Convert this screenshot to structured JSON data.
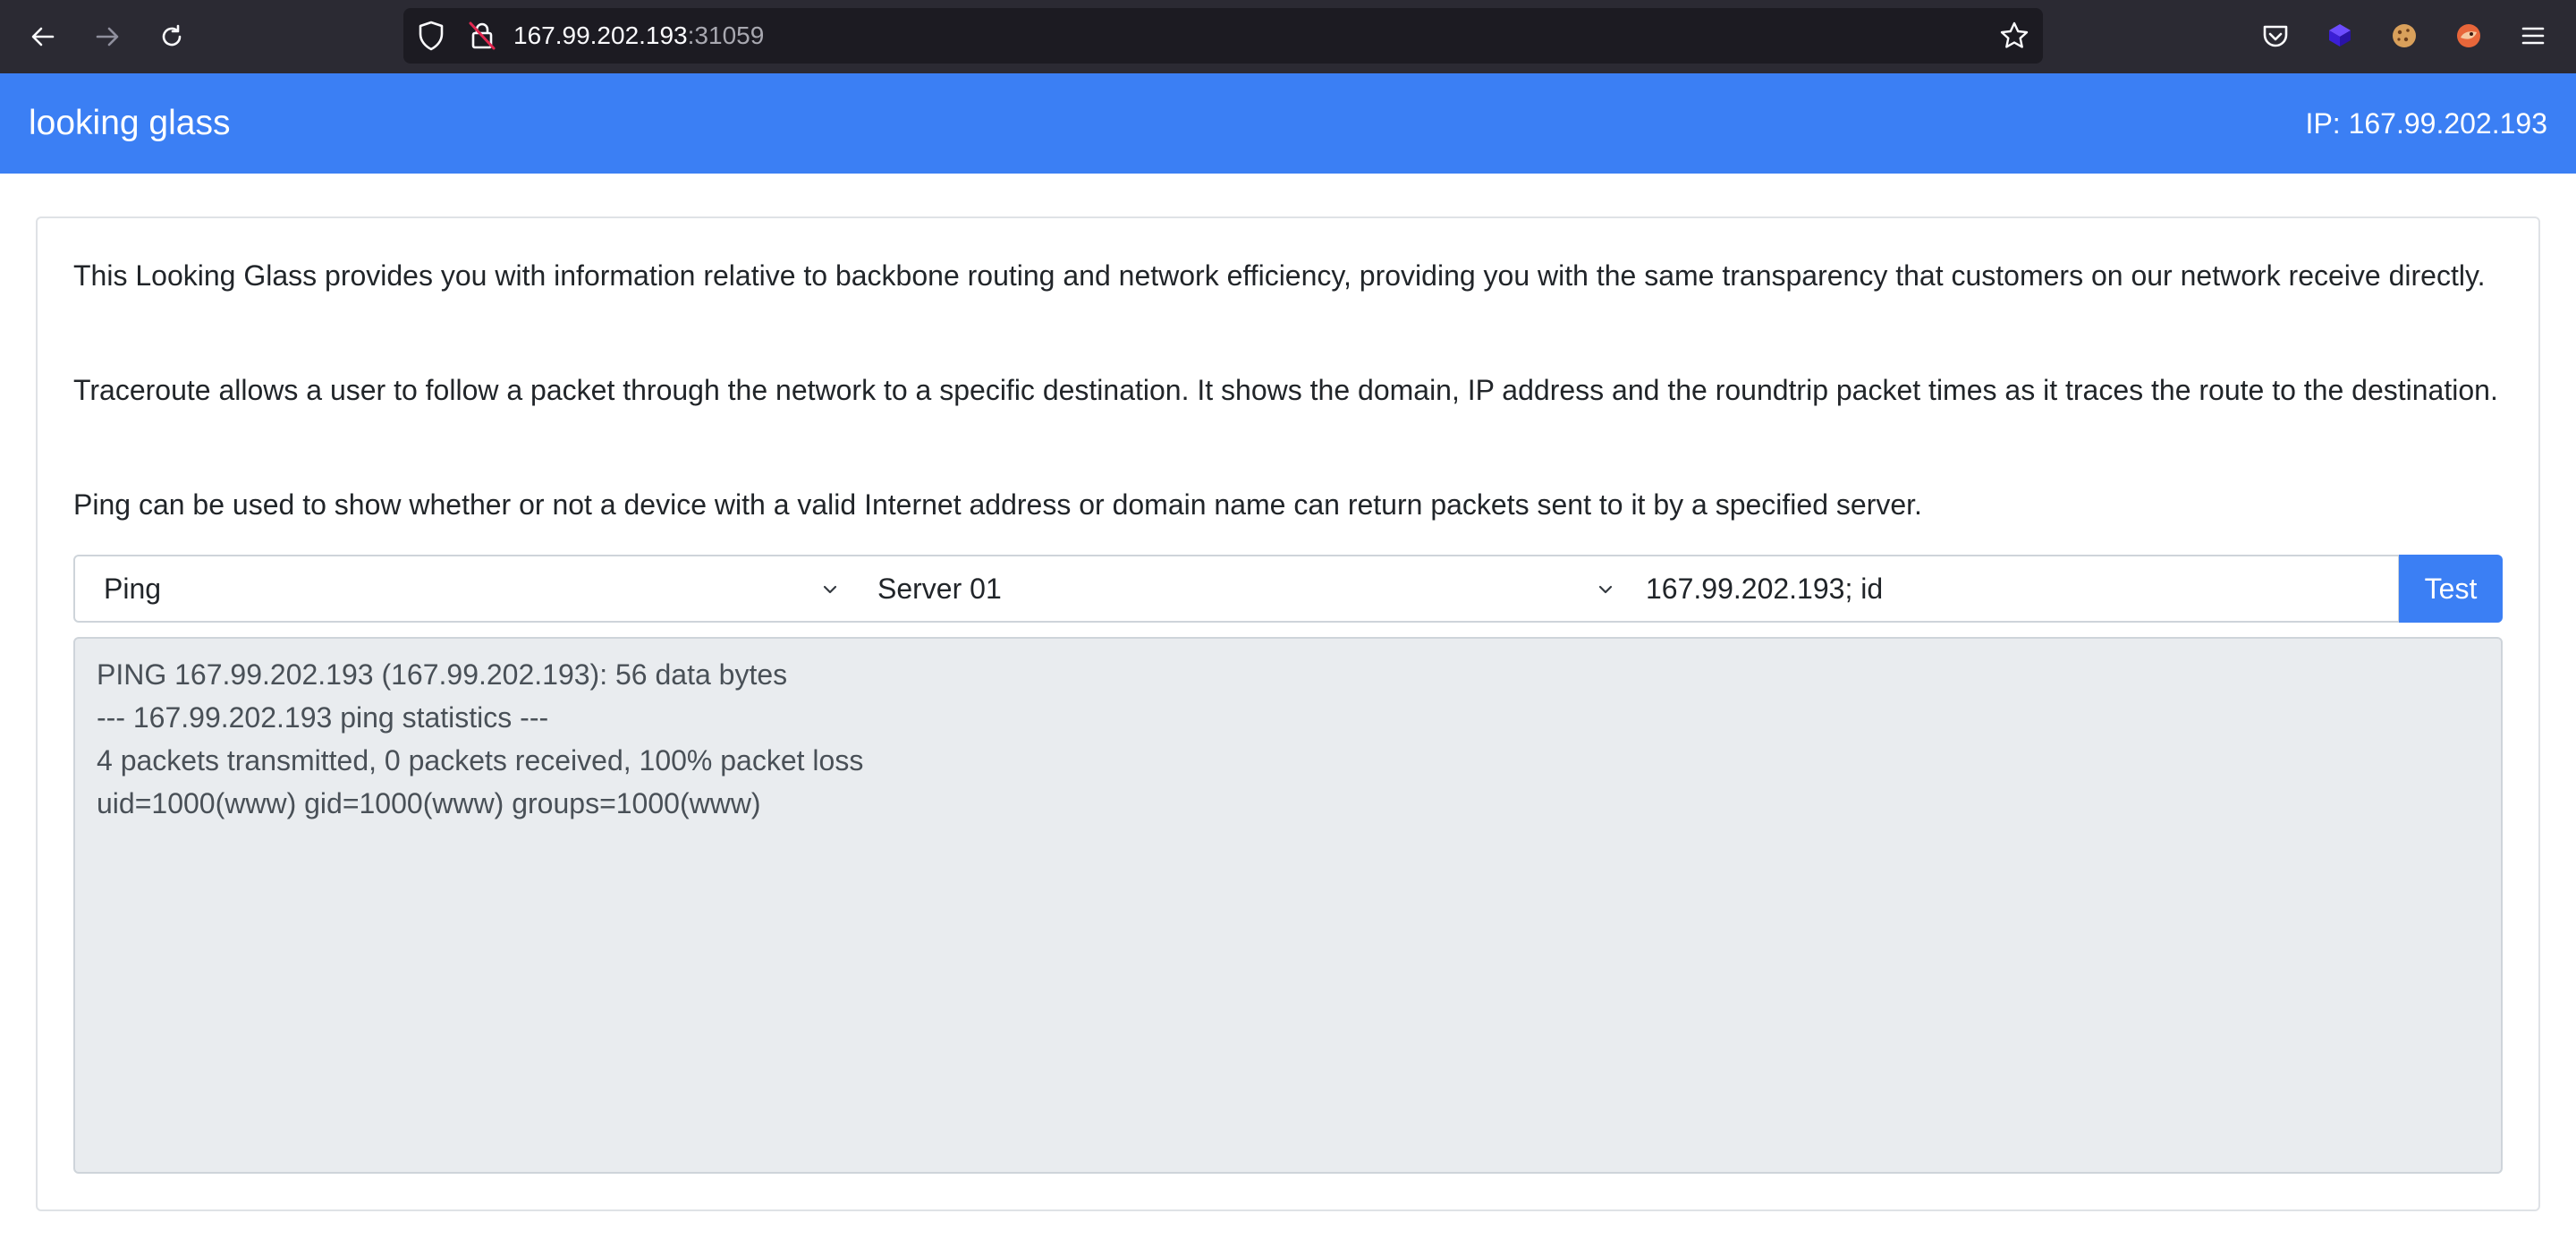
{
  "browser": {
    "url_host": "167.99.202.193",
    "url_port": ":31059",
    "icons": {
      "back": "arrow-left-icon",
      "forward": "arrow-right-icon",
      "reload": "reload-icon",
      "shield": "shield-icon",
      "lock": "insecure-lock-icon",
      "bookmark": "star-icon",
      "pocket": "pocket-icon",
      "ext1": "extension-cube-icon",
      "ext2": "cookie-icon",
      "ext3": "fox-extension-icon",
      "menu": "hamburger-menu-icon"
    }
  },
  "header": {
    "brand": "looking glass",
    "ip_label": "IP: 167.99.202.193"
  },
  "intro": {
    "p1": "This Looking Glass provides you with information relative to backbone routing and network efficiency, providing you with the same transparency that customers on our network receive directly.",
    "p2": "Traceroute allows a user to follow a packet through the network to a specific destination. It shows the domain, IP address and the roundtrip packet times as it traces the route to the destination.",
    "p3": "Ping can be used to show whether or not a device with a valid Internet address or domain name can return packets sent to it by a specified server."
  },
  "form": {
    "method_selected": "Ping",
    "server_selected": "Server 01",
    "target_value": "167.99.202.193; id",
    "test_label": "Test"
  },
  "output": {
    "lines": [
      "PING 167.99.202.193 (167.99.202.193): 56 data bytes",
      "--- 167.99.202.193 ping statistics ---",
      "4 packets transmitted, 0 packets received, 100% packet loss",
      "uid=1000(www) gid=1000(www) groups=1000(www)"
    ]
  },
  "colors": {
    "chrome_bg": "#2b2a33",
    "urlbar_bg": "#1c1b22",
    "primary": "#3b7ff4",
    "output_bg": "#e9ecef"
  }
}
